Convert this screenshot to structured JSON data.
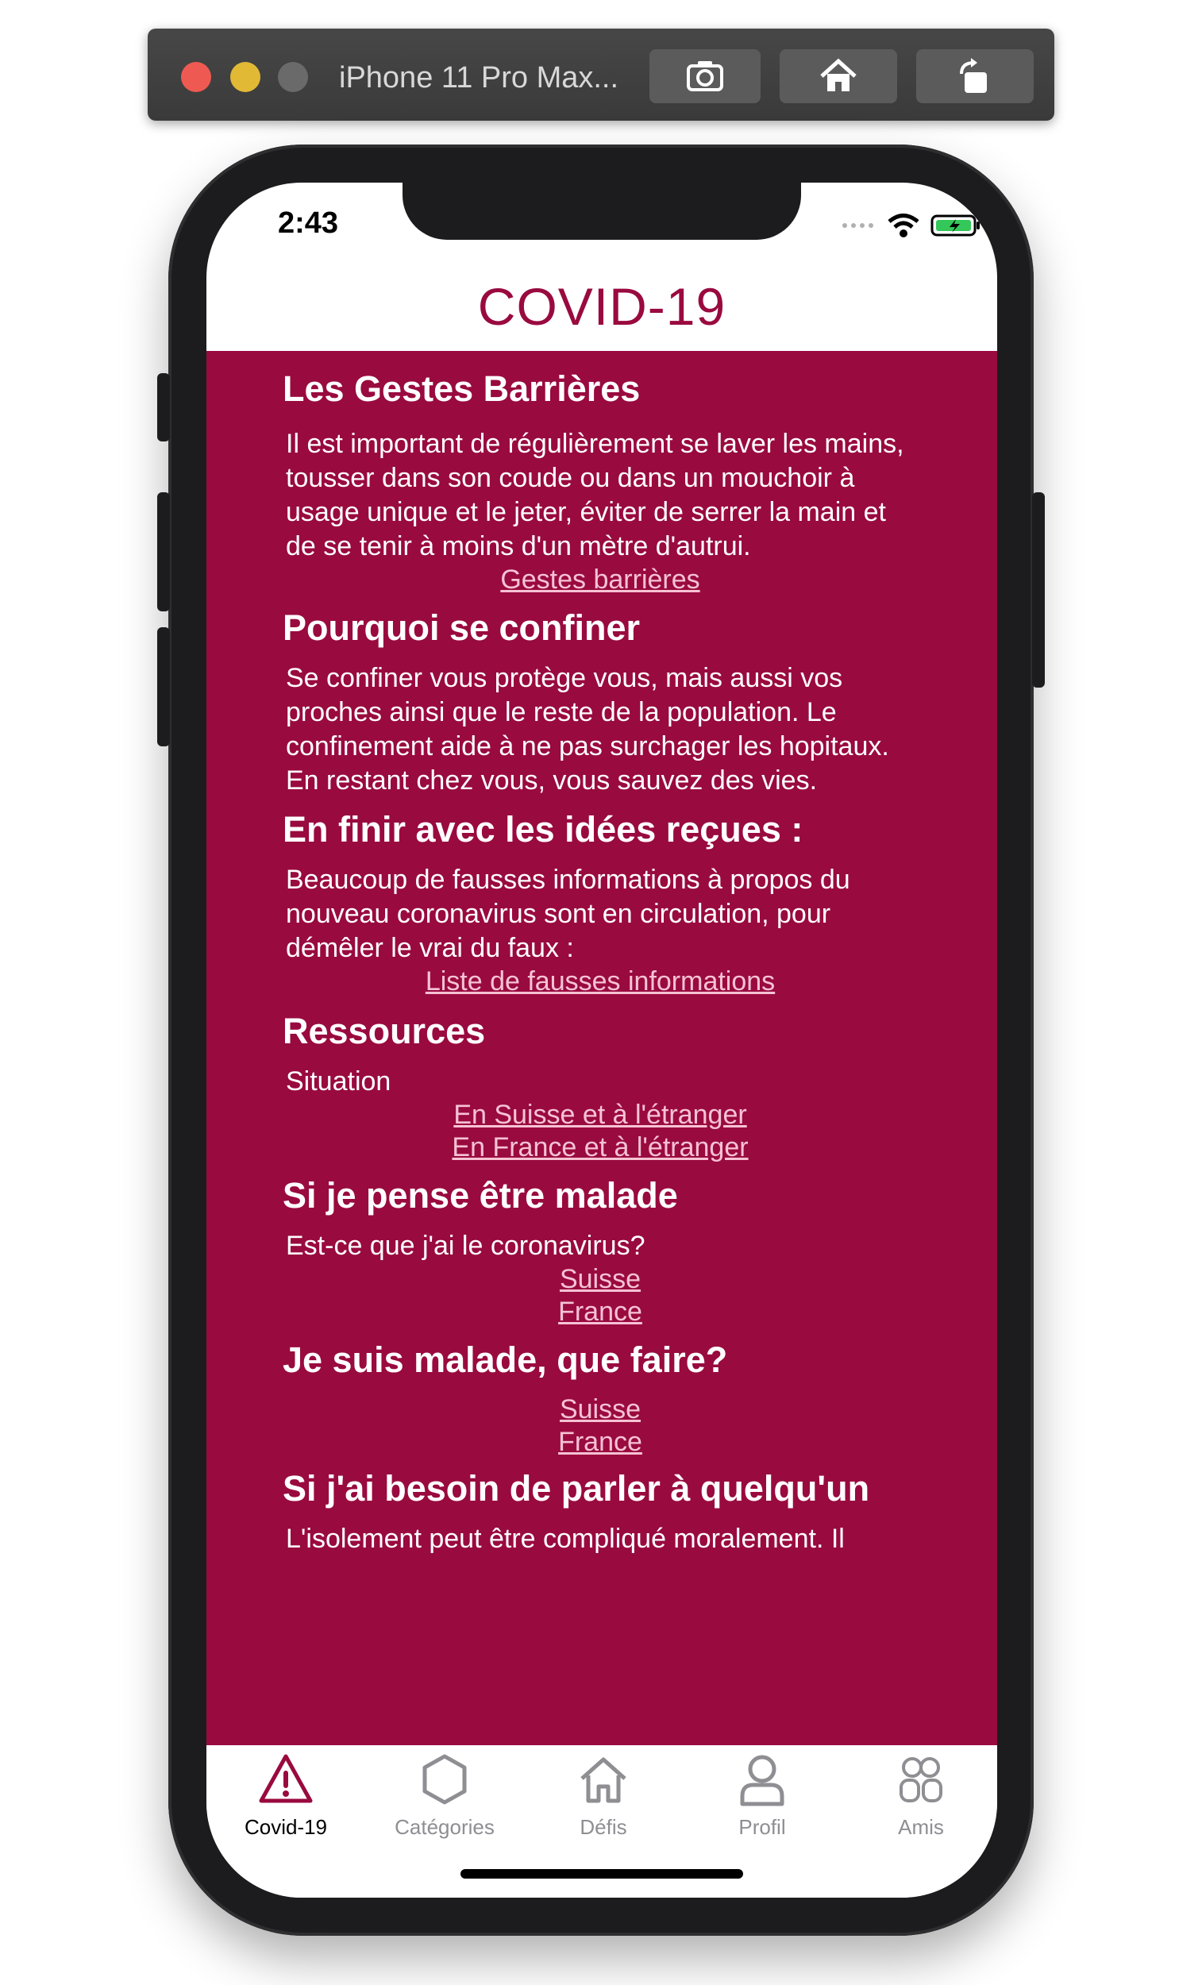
{
  "simulator": {
    "title": "iPhone 11 Pro Max...",
    "buttons": [
      "screenshot-icon",
      "home-icon",
      "rotate-icon"
    ]
  },
  "status_bar": {
    "time": "2:43"
  },
  "app": {
    "title": "COVID-19",
    "accent_color": "#990a3f"
  },
  "sections": {
    "gestes": {
      "heading": "Les Gestes Barrières",
      "body": "Il est important de régulièrement se laver les mains, tousser dans son coude ou dans un mouchoir à usage unique et le jeter, éviter de serrer la main et de se tenir à moins d'un mètre d'autrui.",
      "link": "Gestes barrières"
    },
    "confiner": {
      "heading": "Pourquoi se confiner",
      "body": "Se confiner vous protège vous, mais aussi vos proches ainsi que le reste de la population. Le confinement aide à ne pas surchager les hopitaux. En restant chez vous, vous sauvez des vies."
    },
    "idees": {
      "heading": "En finir avec les idées reçues :",
      "body": "Beaucoup de fausses informations à propos du nouveau coronavirus sont en circulation, pour démêler le vrai du faux :",
      "link": "Liste de fausses informations"
    },
    "ressources": {
      "heading": "Ressources",
      "body": "Situation",
      "links": [
        "En Suisse et à l'étranger",
        "En France et à l'étranger"
      ]
    },
    "malade_pense": {
      "heading": "Si je pense être malade",
      "body": "Est-ce que j'ai le coronavirus?",
      "links": [
        "Suisse",
        "France"
      ]
    },
    "malade_faire": {
      "heading": "Je suis malade, que faire?",
      "links": [
        "Suisse",
        "France"
      ]
    },
    "parler": {
      "heading": "Si j'ai besoin de parler à quelqu'un",
      "body": "L'isolement peut être compliqué moralement. Il"
    }
  },
  "tabs": [
    {
      "label": "Covid-19",
      "icon": "warning-icon",
      "active": true
    },
    {
      "label": "Catégories",
      "icon": "hexagon-icon",
      "active": false
    },
    {
      "label": "Défis",
      "icon": "home-icon",
      "active": false
    },
    {
      "label": "Profil",
      "icon": "person-icon",
      "active": false
    },
    {
      "label": "Amis",
      "icon": "friends-icon",
      "active": false
    }
  ]
}
